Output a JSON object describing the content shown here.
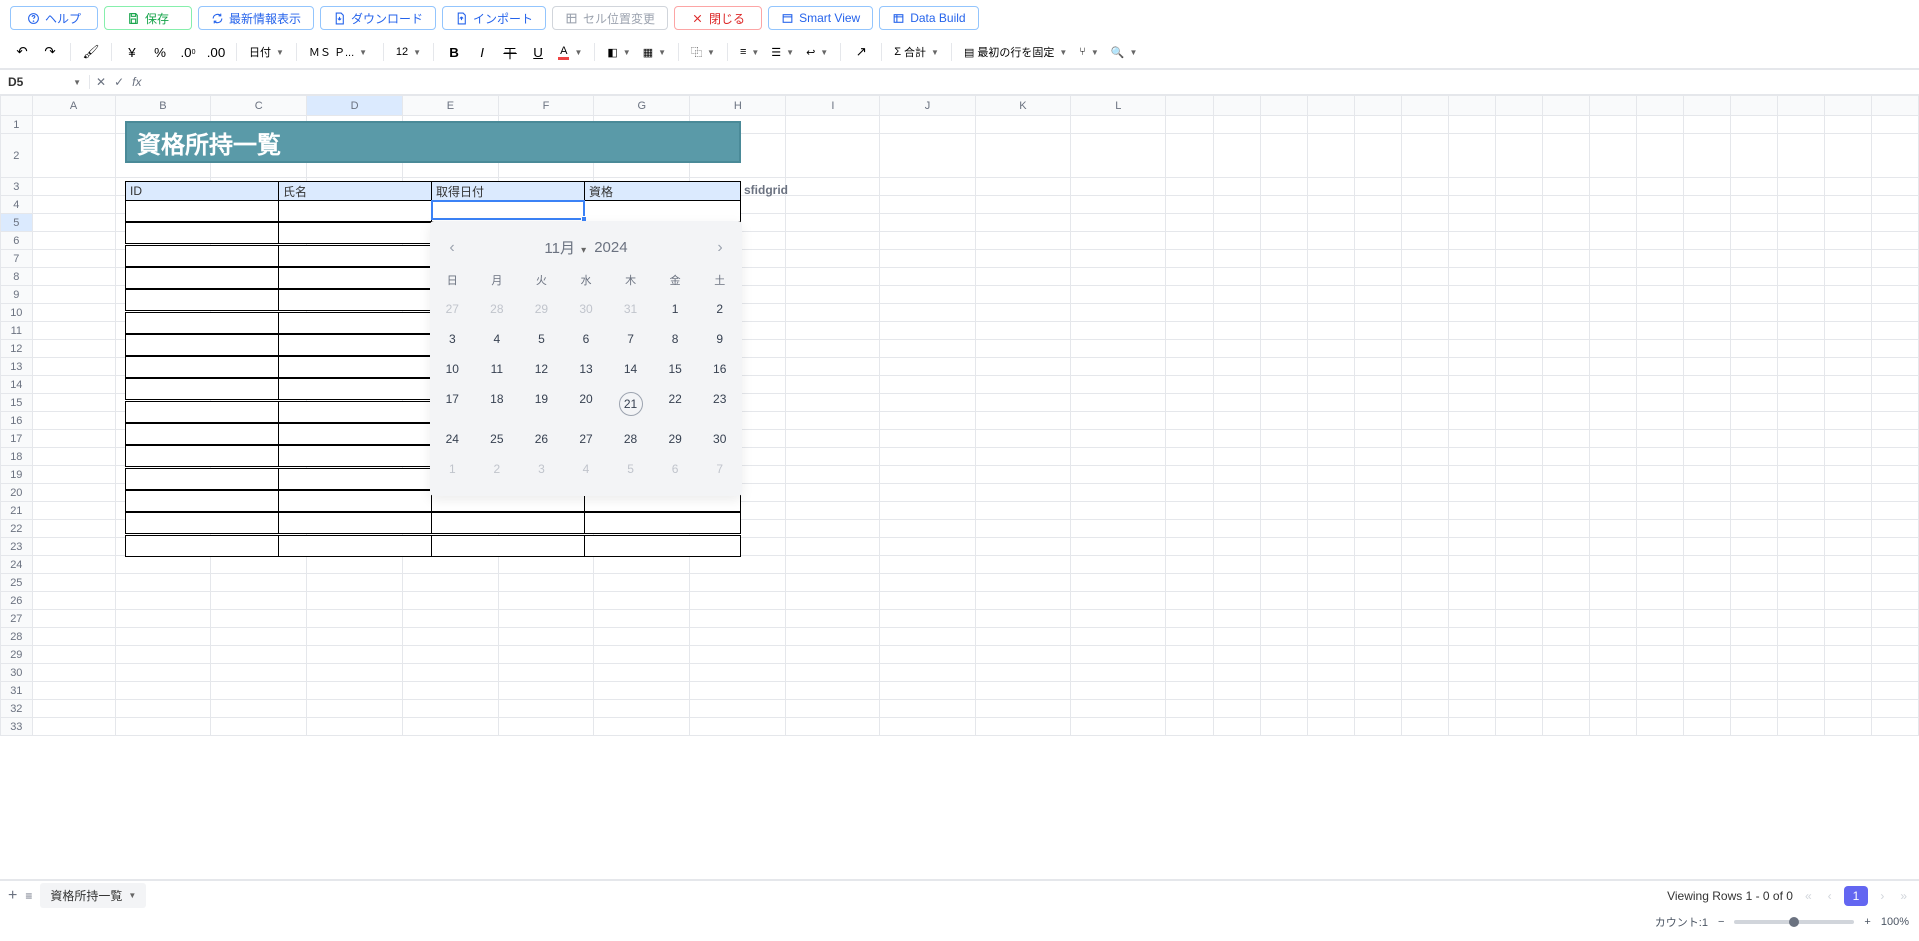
{
  "toolbar": {
    "help": "ヘルプ",
    "save": "保存",
    "refresh": "最新情報表示",
    "download": "ダウンロード",
    "import": "インポート",
    "cellpos": "セル位置変更",
    "close": "閉じる",
    "smartview": "Smart View",
    "databuild": "Data Build"
  },
  "format": {
    "date": "日付",
    "font": "ＭＳ Ｐ...",
    "size": "12",
    "sum": "合計",
    "freeze": "最初の行を固定",
    "currency": "¥",
    "percent": "%"
  },
  "namebox": "D5",
  "columns": [
    "A",
    "B",
    "C",
    "D",
    "E",
    "F",
    "G",
    "H",
    "I",
    "J",
    "K",
    "L"
  ],
  "rowcount": 33,
  "selectedRow": 5,
  "sheet": {
    "title": "資格所持一覧",
    "headers": {
      "id": "ID",
      "name": "氏名",
      "date": "取得日付",
      "cert": "資格"
    },
    "sfid": "sfidgrid"
  },
  "datepicker": {
    "month": "11月",
    "year": "2024",
    "dow": [
      "日",
      "月",
      "火",
      "水",
      "木",
      "金",
      "土"
    ],
    "weeks": [
      [
        {
          "d": "27",
          "m": true
        },
        {
          "d": "28",
          "m": true
        },
        {
          "d": "29",
          "m": true
        },
        {
          "d": "30",
          "m": true
        },
        {
          "d": "31",
          "m": true
        },
        {
          "d": "1"
        },
        {
          "d": "2"
        }
      ],
      [
        {
          "d": "3"
        },
        {
          "d": "4"
        },
        {
          "d": "5"
        },
        {
          "d": "6"
        },
        {
          "d": "7"
        },
        {
          "d": "8"
        },
        {
          "d": "9"
        }
      ],
      [
        {
          "d": "10"
        },
        {
          "d": "11"
        },
        {
          "d": "12"
        },
        {
          "d": "13"
        },
        {
          "d": "14"
        },
        {
          "d": "15"
        },
        {
          "d": "16"
        }
      ],
      [
        {
          "d": "17"
        },
        {
          "d": "18"
        },
        {
          "d": "19"
        },
        {
          "d": "20"
        },
        {
          "d": "21",
          "t": true
        },
        {
          "d": "22"
        },
        {
          "d": "23"
        }
      ],
      [
        {
          "d": "24"
        },
        {
          "d": "25"
        },
        {
          "d": "26"
        },
        {
          "d": "27"
        },
        {
          "d": "28"
        },
        {
          "d": "29"
        },
        {
          "d": "30"
        }
      ],
      [
        {
          "d": "1",
          "m": true
        },
        {
          "d": "2",
          "m": true
        },
        {
          "d": "3",
          "m": true
        },
        {
          "d": "4",
          "m": true
        },
        {
          "d": "5",
          "m": true
        },
        {
          "d": "6",
          "m": true
        },
        {
          "d": "7",
          "m": true
        }
      ]
    ]
  },
  "tabs": {
    "active": "資格所持一覧"
  },
  "pager": {
    "text": "Viewing Rows 1 - 0 of 0",
    "page": "1"
  },
  "status": {
    "count": "カウント:1",
    "zoom": "100%"
  }
}
